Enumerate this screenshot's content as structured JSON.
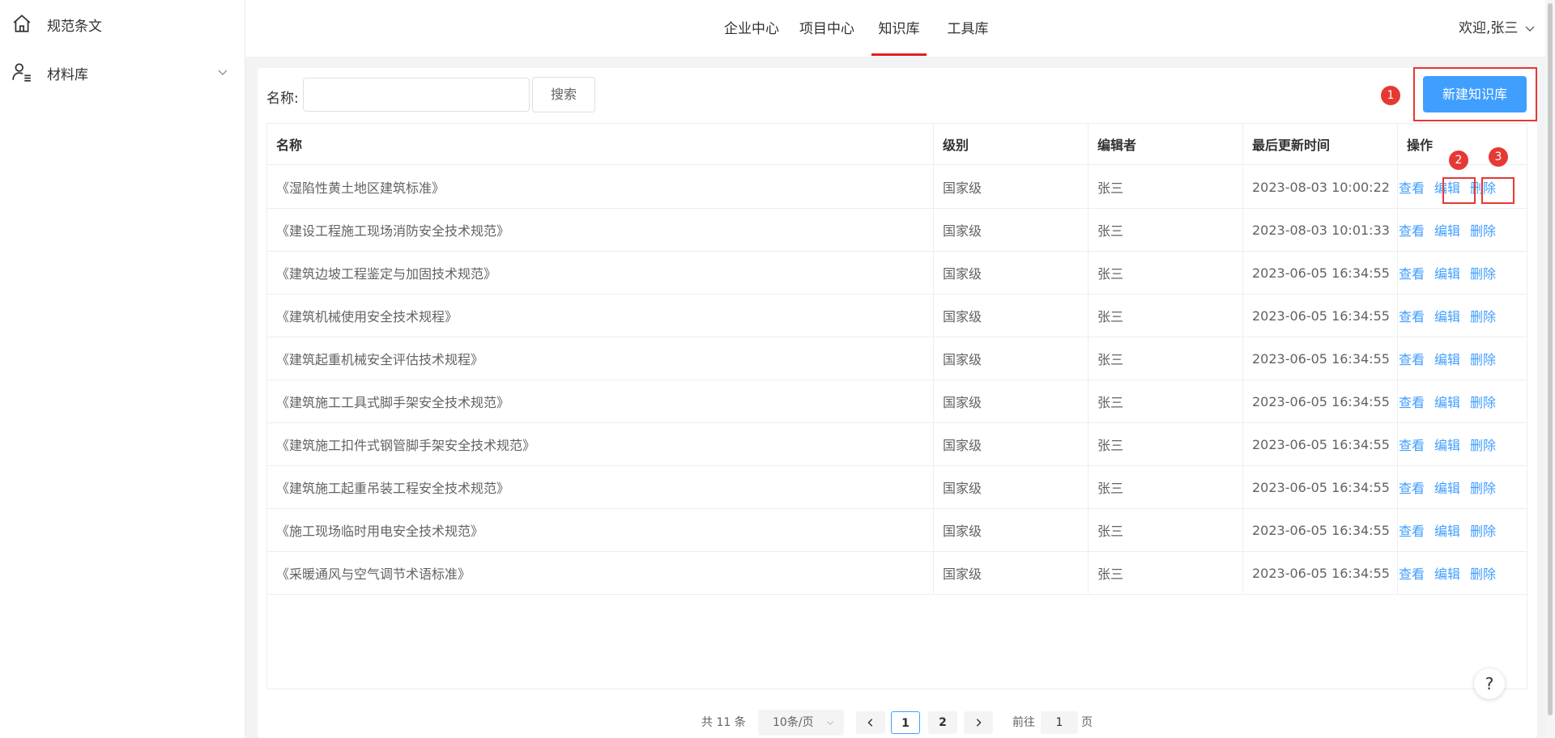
{
  "sidebar": {
    "items": [
      {
        "label": "规范条文",
        "icon": "home-icon"
      },
      {
        "label": "材料库",
        "icon": "user-list-icon",
        "expandable": true
      }
    ]
  },
  "topnav": {
    "tabs": [
      {
        "label": "企业中心"
      },
      {
        "label": "项目中心"
      },
      {
        "label": "知识库",
        "active": true
      },
      {
        "label": "工具库"
      }
    ],
    "user_greeting": "欢迎,张三"
  },
  "toolbar": {
    "search_label": "名称:",
    "search_value": "",
    "search_button": "搜索",
    "new_button": "新建知识库"
  },
  "annotations": [
    "1",
    "2",
    "3"
  ],
  "table": {
    "headers": [
      "名称",
      "级别",
      "编辑者",
      "最后更新时间",
      "操作"
    ],
    "actions": [
      "查看",
      "编辑",
      "删除"
    ],
    "rows": [
      {
        "name": "《湿陷性黄土地区建筑标准》",
        "level": "国家级",
        "editor": "张三",
        "updated": "2023-08-03 10:00:22"
      },
      {
        "name": "《建设工程施工现场消防安全技术规范》",
        "level": "国家级",
        "editor": "张三",
        "updated": "2023-08-03 10:01:33"
      },
      {
        "name": "《建筑边坡工程鉴定与加固技术规范》",
        "level": "国家级",
        "editor": "张三",
        "updated": "2023-06-05 16:34:55"
      },
      {
        "name": "《建筑机械使用安全技术规程》",
        "level": "国家级",
        "editor": "张三",
        "updated": "2023-06-05 16:34:55"
      },
      {
        "name": "《建筑起重机械安全评估技术规程》",
        "level": "国家级",
        "editor": "张三",
        "updated": "2023-06-05 16:34:55"
      },
      {
        "name": "《建筑施工工具式脚手架安全技术规范》",
        "level": "国家级",
        "editor": "张三",
        "updated": "2023-06-05 16:34:55"
      },
      {
        "name": "《建筑施工扣件式钢管脚手架安全技术规范》",
        "level": "国家级",
        "editor": "张三",
        "updated": "2023-06-05 16:34:55"
      },
      {
        "name": "《建筑施工起重吊装工程安全技术规范》",
        "level": "国家级",
        "editor": "张三",
        "updated": "2023-06-05 16:34:55"
      },
      {
        "name": "《施工现场临时用电安全技术规范》",
        "level": "国家级",
        "editor": "张三",
        "updated": "2023-06-05 16:34:55"
      },
      {
        "name": "《采暖通风与空气调节术语标准》",
        "level": "国家级",
        "editor": "张三",
        "updated": "2023-06-05 16:34:55"
      }
    ]
  },
  "pagination": {
    "total_text": "共 11 条",
    "page_size": "10条/页",
    "pages": [
      "1",
      "2"
    ],
    "current_page": "1",
    "goto_prefix": "前往",
    "goto_value": "1",
    "goto_suffix": "页"
  },
  "help": {
    "label": "?"
  },
  "colors": {
    "primary": "#409eff",
    "annotation": "#e53935",
    "active_tab_underline": "#e02020"
  }
}
